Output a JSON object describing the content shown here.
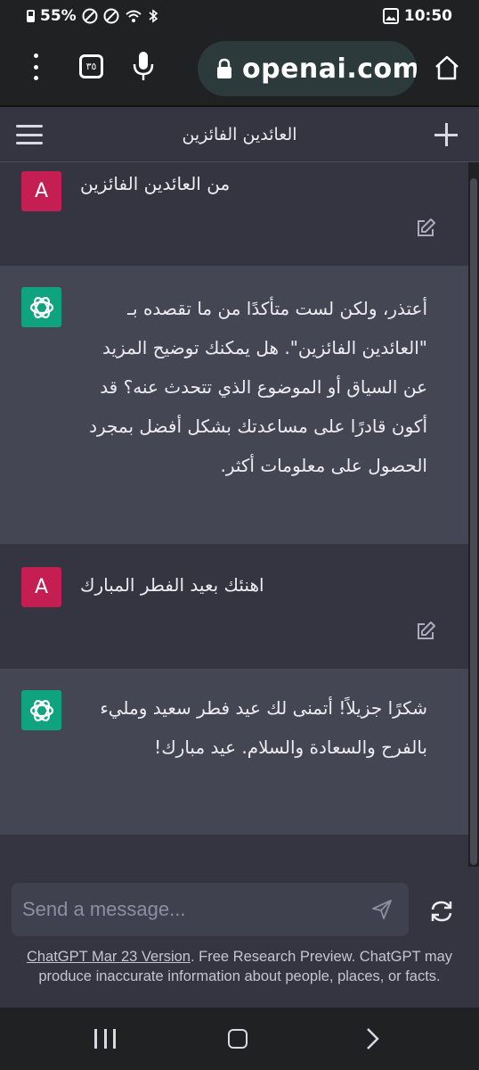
{
  "status_bar": {
    "battery": "55%",
    "time": "10:50"
  },
  "browser": {
    "tab_count": "٣٥",
    "url": "openai.com"
  },
  "header": {
    "title": "العائدين الفائزين"
  },
  "conversation": [
    {
      "role": "user",
      "avatar": "A",
      "text": "من العائدين الفائزين"
    },
    {
      "role": "assistant",
      "text": "أعتذر، ولكن لست متأكدًا من ما تقصده بـ \"العائدين الفائزين\". هل يمكنك توضيح المزيد عن السياق أو الموضوع الذي تتحدث عنه؟ قد أكون قادرًا على مساعدتك بشكل أفضل بمجرد الحصول على معلومات أكثر."
    },
    {
      "role": "user",
      "avatar": "A",
      "text": "اهنئك بعيد الفطر المبارك"
    },
    {
      "role": "assistant",
      "text": "شكرًا جزيلاً! أتمنى لك عيد فطر سعيد ومليء بالفرح والسعادة والسلام. عيد مبارك!"
    }
  ],
  "composer": {
    "placeholder": "Send a message..."
  },
  "footer": {
    "link_text": "ChatGPT Mar 23 Version",
    "note": ". Free Research Preview. ChatGPT may produce inaccurate information about people, places, or facts."
  },
  "icons": {
    "status": [
      "battery-icon",
      "dnd-icon",
      "blocked-icon",
      "wifi-icon",
      "bluetooth-icon",
      "gallery-icon"
    ],
    "message_actions": [
      "clipboard-icon",
      "thumbs-up-icon",
      "thumbs-down-icon"
    ],
    "edit": "edit-icon",
    "send": "send-icon",
    "regenerate": "regenerate-icon"
  },
  "colors": {
    "user_avatar": "#c41e53",
    "assistant_avatar": "#10a37f",
    "user_bg": "#343541",
    "assistant_bg": "#444654"
  }
}
